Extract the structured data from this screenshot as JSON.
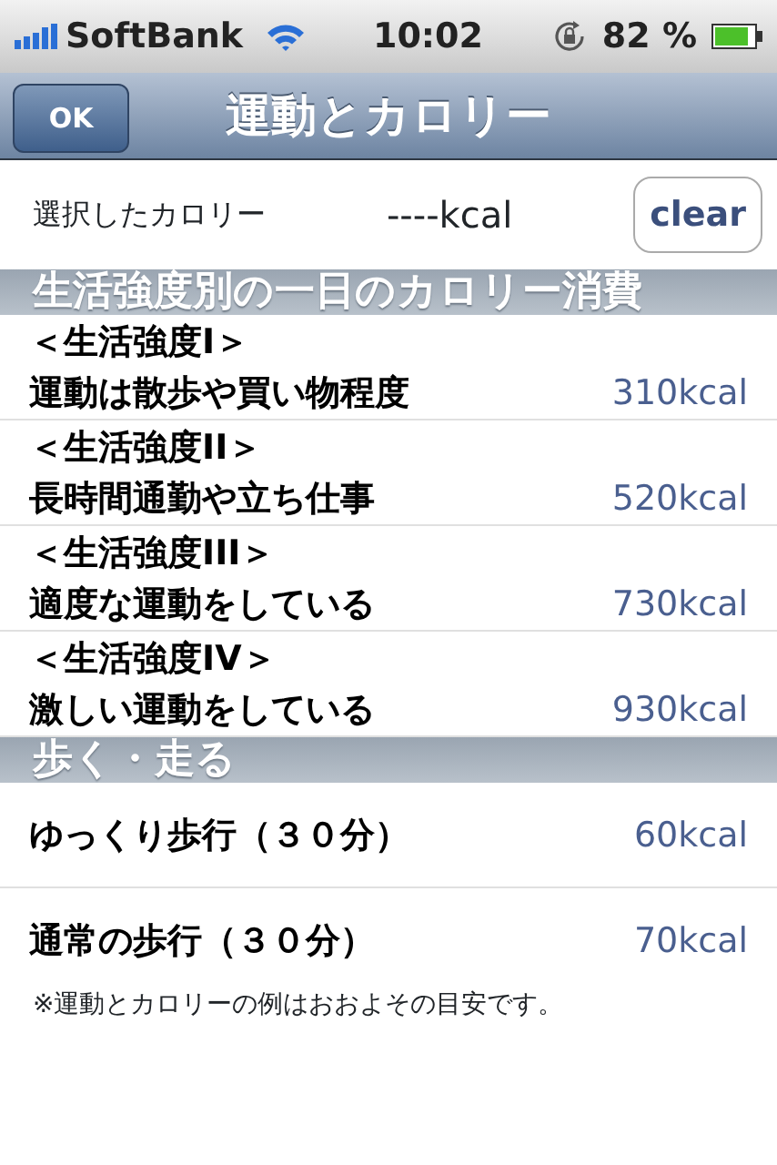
{
  "status_bar": {
    "carrier": "SoftBank",
    "time": "10:02",
    "battery": "82 %"
  },
  "nav_bar": {
    "title": "運動とカロリー",
    "back_button": "OK"
  },
  "summary": {
    "label": "選択したカロリー",
    "value": "----kcal",
    "clear_button": "clear"
  },
  "sections": [
    {
      "header": "生活強度別の一日のカロリー消費",
      "rows": [
        {
          "lines": [
            "＜生活強度I＞",
            "運動は散歩や買い物程度"
          ],
          "value": "310kcal"
        },
        {
          "lines": [
            "＜生活強度II＞",
            "長時間通勤や立ち仕事"
          ],
          "value": "520kcal"
        },
        {
          "lines": [
            "＜生活強度III＞",
            "適度な運動をしている"
          ],
          "value": "730kcal"
        },
        {
          "lines": [
            "＜生活強度IV＞",
            "激しい運動をしている"
          ],
          "value": "930kcal"
        }
      ]
    },
    {
      "header": "歩く・走る",
      "rows": [
        {
          "lines": [
            "ゆっくり歩行（３０分）"
          ],
          "value": "60kcal"
        },
        {
          "lines": [
            "通常の歩行（３０分）"
          ],
          "value": "70kcal"
        }
      ]
    }
  ],
  "footnote": "※運動とカロリーの例はおおよその目安です。"
}
